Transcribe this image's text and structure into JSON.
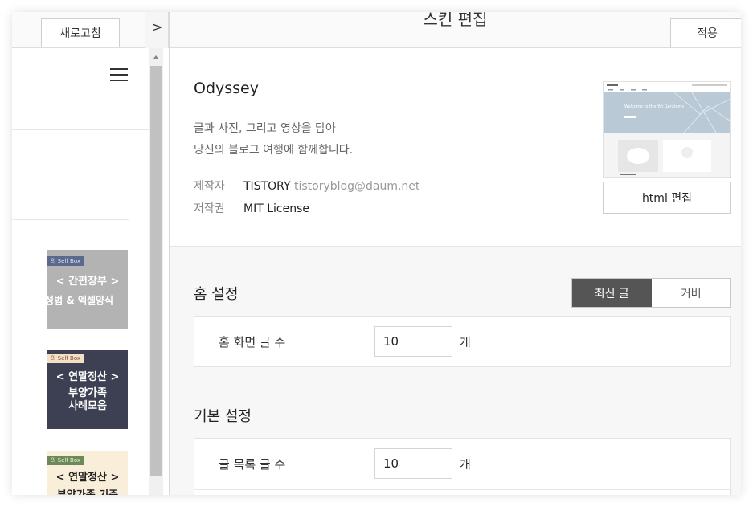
{
  "left_panel": {
    "refresh_label": "새로고침",
    "toggle_label": ">",
    "thumbnails": [
      {
        "tag": "의 Self Box",
        "line1": "< 간편장부 >",
        "line2": "작성법 & 엑셀양식"
      },
      {
        "tag": "의 Self Box",
        "line1": "< 연말정산 >",
        "line2a": "부양가족",
        "line2b": "사례모음"
      },
      {
        "tag": "의 Self Box",
        "line1": "< 연말정산 >",
        "line2": "부양가족 기준"
      }
    ]
  },
  "right_panel": {
    "title": "스킨 편집",
    "apply_label": "적용",
    "skin": {
      "name": "Odyssey",
      "description_line1": "글과 사진, 그리고 영상을 담아",
      "description_line2": "당신의 블로그 여행에 함께합니다.",
      "maker_key": "제작자",
      "maker_value": "TISTORY",
      "maker_email": "tistoryblog@daum.net",
      "license_key": "저작권",
      "license_value": "MIT License",
      "html_edit_label": "html 편집",
      "thumbnail_caption": "Welcome to the Yot Gentlemy"
    },
    "home_settings": {
      "title": "홈 설정",
      "segment_latest": "최신 글",
      "segment_cover": "커버",
      "row_label": "홈 화면 글 수",
      "row_value": "10",
      "row_unit": "개"
    },
    "basic_settings": {
      "title": "기본 설정",
      "row_label": "글 목록 글 수",
      "row_value": "10",
      "row_unit": "개"
    }
  },
  "colors": {
    "segment_active": "#555555",
    "settings_bg": "#f7f7f7"
  }
}
